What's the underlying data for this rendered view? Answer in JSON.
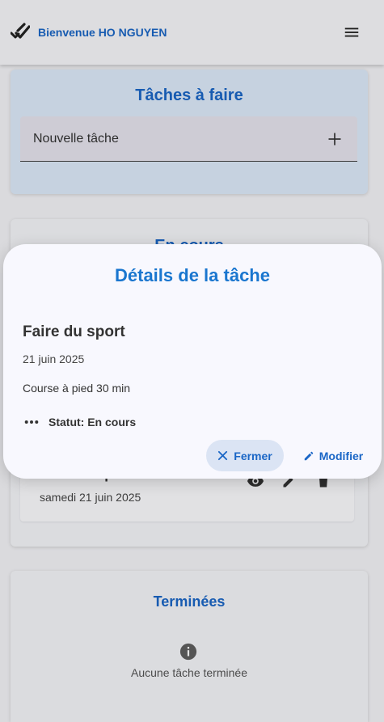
{
  "header": {
    "title": "Bienvenue HO NGUYEN",
    "logo_icon": "double-check-icon",
    "menu_icon": "hamburger-menu-icon"
  },
  "todo_section": {
    "title": "Tâches à faire",
    "new_task_placeholder": "Nouvelle tâche",
    "add_icon": "plus-icon"
  },
  "inprogress_section": {
    "title": "En cours",
    "tasks": [
      {
        "name": "Faire du sport",
        "date": "samedi 21 juin 2025",
        "actions": [
          "eye-icon",
          "pencil-icon",
          "trash-icon"
        ]
      }
    ]
  },
  "done_section": {
    "title": "Terminées",
    "empty_icon": "info-icon",
    "empty_text": "Aucune tâche terminée"
  },
  "dialog": {
    "title": "Détails de la tâche",
    "task_name": "Faire du sport",
    "task_date": "21 juin 2025",
    "task_description": "Course à pied 30 min",
    "status": "Statut: En cours",
    "close_label": "Fermer",
    "edit_label": "Modifier"
  },
  "colors": {
    "accent": "#1a66c6",
    "dialog_title": "#1a76cf",
    "todo_card_bg": "#ddeafa",
    "close_button_bg": "#dbe4f4"
  }
}
